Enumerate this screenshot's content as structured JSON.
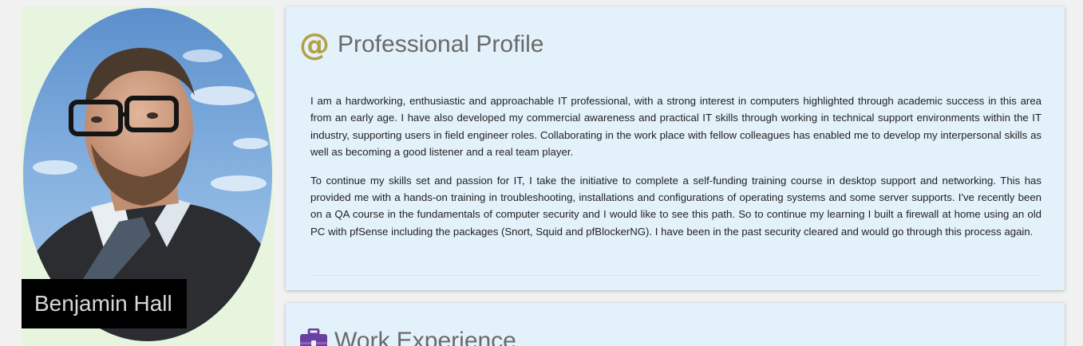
{
  "profile": {
    "name": "Benjamin Hall",
    "photo_alt": "portrait-photo"
  },
  "professional_profile": {
    "icon": "at-icon",
    "title": "Professional Profile",
    "paragraphs": [
      "I am a hardworking, enthusiastic and approachable IT professional, with a strong interest in computers highlighted through academic success in this area from an early age. I have also developed my commercial awareness and practical IT skills through working in technical support environments within the IT industry, supporting users in field engineer roles. Collaborating in the work place with fellow colleagues has enabled me to develop my interpersonal skills as well as becoming a good listener and a real team player.",
      "To continue my skills set and passion for IT, I take the initiative to complete a self-funding training course in desktop support and networking. This has provided me with a hands-on training in troubleshooting, installations and configurations of operating systems and some server supports. I've recently been on a QA course in the fundamentals of computer security and I would like to see this path. So to continue my learning I built a firewall at home using an old PC with pfSense including the packages (Snort, Squid and pfBlockerNG). I have been in the past security cleared and would go through this process again."
    ]
  },
  "work_experience": {
    "icon": "briefcase-icon",
    "title": "Work Experience"
  },
  "colors": {
    "page_bg": "#f1f1f1",
    "left_card_bg": "#e7f4de",
    "card_bg": "#e3f1fb",
    "accent_gold": "#b3a047",
    "accent_purple": "#6b3fa0",
    "title_gray": "#6a6a6a"
  }
}
